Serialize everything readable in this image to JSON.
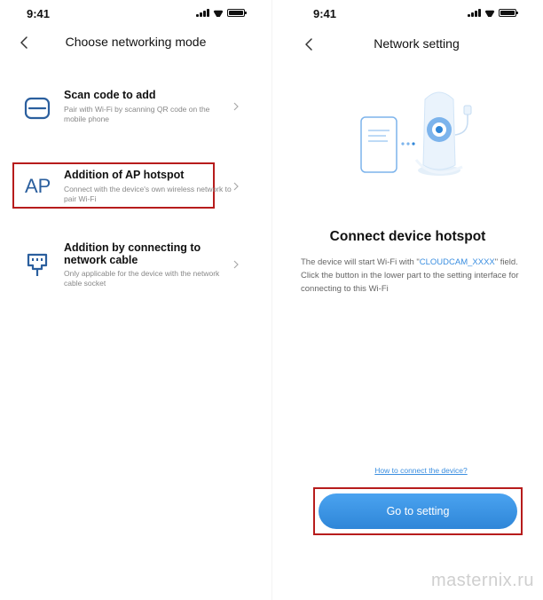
{
  "left_screen": {
    "status_time": "9:41",
    "title": "Choose networking mode",
    "options": [
      {
        "icon": "scan-qr-icon",
        "title": "Scan code to add",
        "desc": "Pair with Wi-Fi by scanning QR code on the mobile phone"
      },
      {
        "icon": "ap-hotspot-icon",
        "icon_text": "AP",
        "title": "Addition of AP hotspot",
        "desc": "Connect with the device's own wireless network to pair Wi-Fi"
      },
      {
        "icon": "network-cable-icon",
        "title": "Addition by connecting to network cable",
        "desc": "Only applicable for the device with the network cable socket"
      }
    ]
  },
  "right_screen": {
    "status_time": "9:41",
    "title": "Network setting",
    "hero_title": "Connect device hotspot",
    "body_before": "The device will start Wi-Fi with \"",
    "body_highlight": "CLOUDCAM_XXXX",
    "body_after": "\" field. Click the button in the lower part to the setting interface for connecting to this Wi-Fi",
    "help_link": "How to connect the device?",
    "button_label": "Go to setting"
  },
  "watermark": "masternix.ru",
  "colors": {
    "accent": "#3a8ee0",
    "highlight_border": "#b71c1c",
    "icon": "#2b5f9e"
  }
}
